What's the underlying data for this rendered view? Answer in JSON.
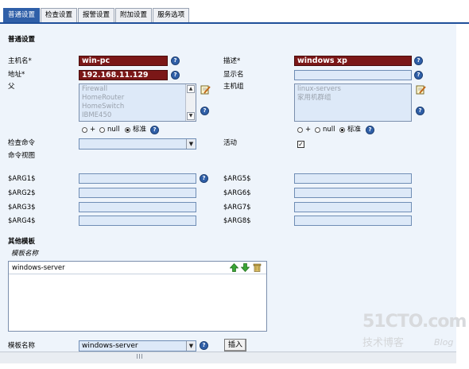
{
  "tabs": [
    "普通设置",
    "检查设置",
    "报警设置",
    "附加设置",
    "服务选项"
  ],
  "section_title": "普通设置",
  "host": {
    "hostname_label": "主机名*",
    "hostname_value": "win-pc",
    "description_label": "描述*",
    "description_value": "windows xp",
    "address_label": "地址*",
    "address_value": "192.168.11.129",
    "display_name_label": "显示名",
    "display_name_value": "",
    "parent_label": "父",
    "hostgroup_label": "主机组"
  },
  "parents_list": [
    "Firewall",
    "HomeRouter",
    "HomeSwitch",
    "IBME450"
  ],
  "hostgroups_list": [
    "linux-servers",
    "家用机群组"
  ],
  "radio_labels": {
    "plus": "+",
    "null": "null",
    "standard": "标准"
  },
  "check_command_label": "检查命令",
  "active_label": "活动",
  "active_checked": true,
  "command_view_label": "命令视图",
  "args_left": [
    "$ARG1$",
    "$ARG2$",
    "$ARG3$",
    "$ARG4$"
  ],
  "args_right": [
    "$ARG5$",
    "$ARG6$",
    "$ARG7$",
    "$ARG8$"
  ],
  "templates": {
    "section_label": "其他模板",
    "name_header": "模板名称",
    "items": [
      "windows-server"
    ],
    "bottom_label": "模板名称",
    "selected": "windows-server",
    "insert_button": "插入"
  },
  "watermark": {
    "line1": "51CTO.com",
    "line2": "技术博客",
    "line3": "Blog"
  },
  "icons": {
    "help": "question-circle-icon",
    "edit": "notepad-edit-icon",
    "up": "green-up-arrow-icon",
    "down": "green-down-arrow-icon",
    "delete": "trash-icon"
  }
}
